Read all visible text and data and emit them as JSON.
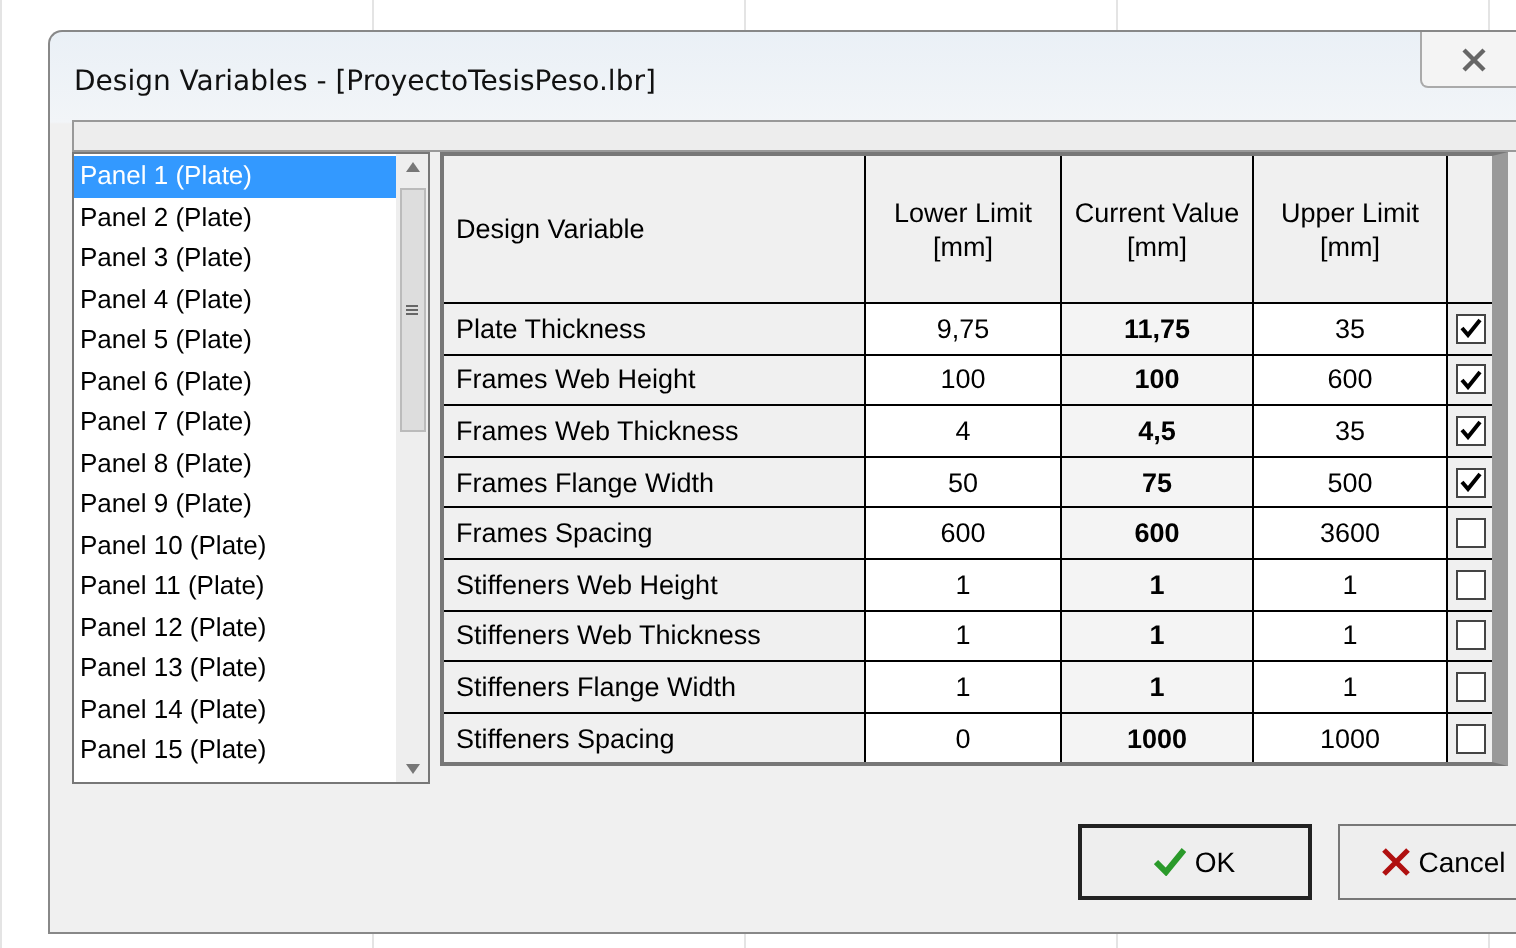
{
  "window": {
    "title": "Design Variables - [ProyectoTesisPeso.lbr]"
  },
  "panels": [
    {
      "label": "Panel 1 (Plate)",
      "selected": true
    },
    {
      "label": "Panel 2 (Plate)",
      "selected": false
    },
    {
      "label": "Panel 3 (Plate)",
      "selected": false
    },
    {
      "label": "Panel 4 (Plate)",
      "selected": false
    },
    {
      "label": "Panel 5 (Plate)",
      "selected": false
    },
    {
      "label": "Panel 6 (Plate)",
      "selected": false
    },
    {
      "label": "Panel 7 (Plate)",
      "selected": false
    },
    {
      "label": "Panel 8 (Plate)",
      "selected": false
    },
    {
      "label": "Panel 9 (Plate)",
      "selected": false
    },
    {
      "label": "Panel 10 (Plate)",
      "selected": false
    },
    {
      "label": "Panel 11 (Plate)",
      "selected": false
    },
    {
      "label": "Panel 12 (Plate)",
      "selected": false
    },
    {
      "label": "Panel 13 (Plate)",
      "selected": false
    },
    {
      "label": "Panel 14 (Plate)",
      "selected": false
    },
    {
      "label": "Panel 15 (Plate)",
      "selected": false
    }
  ],
  "table": {
    "columns": [
      "Design Variable",
      "Lower Limit [mm]",
      "Current Value [mm]",
      "Upper Limit [mm]"
    ],
    "rows": [
      {
        "name": "Plate Thickness",
        "lower": "9,75",
        "current": "11,75",
        "upper": "35",
        "checked": true
      },
      {
        "name": "Frames Web Height",
        "lower": "100",
        "current": "100",
        "upper": "600",
        "checked": true
      },
      {
        "name": "Frames Web Thickness",
        "lower": "4",
        "current": "4,5",
        "upper": "35",
        "checked": true
      },
      {
        "name": "Frames Flange Width",
        "lower": "50",
        "current": "75",
        "upper": "500",
        "checked": true
      },
      {
        "name": "Frames Spacing",
        "lower": "600",
        "current": "600",
        "upper": "3600",
        "checked": false
      },
      {
        "name": "Stiffeners Web Height",
        "lower": "1",
        "current": "1",
        "upper": "1",
        "checked": false
      },
      {
        "name": "Stiffeners Web Thickness",
        "lower": "1",
        "current": "1",
        "upper": "1",
        "checked": false
      },
      {
        "name": "Stiffeners Flange Width",
        "lower": "1",
        "current": "1",
        "upper": "1",
        "checked": false
      },
      {
        "name": "Stiffeners Spacing",
        "lower": "0",
        "current": "1000",
        "upper": "1000",
        "checked": false
      }
    ]
  },
  "buttons": [
    {
      "kind": "ok",
      "label": "OK"
    },
    {
      "kind": "cancel",
      "label": "Cancel"
    }
  ]
}
